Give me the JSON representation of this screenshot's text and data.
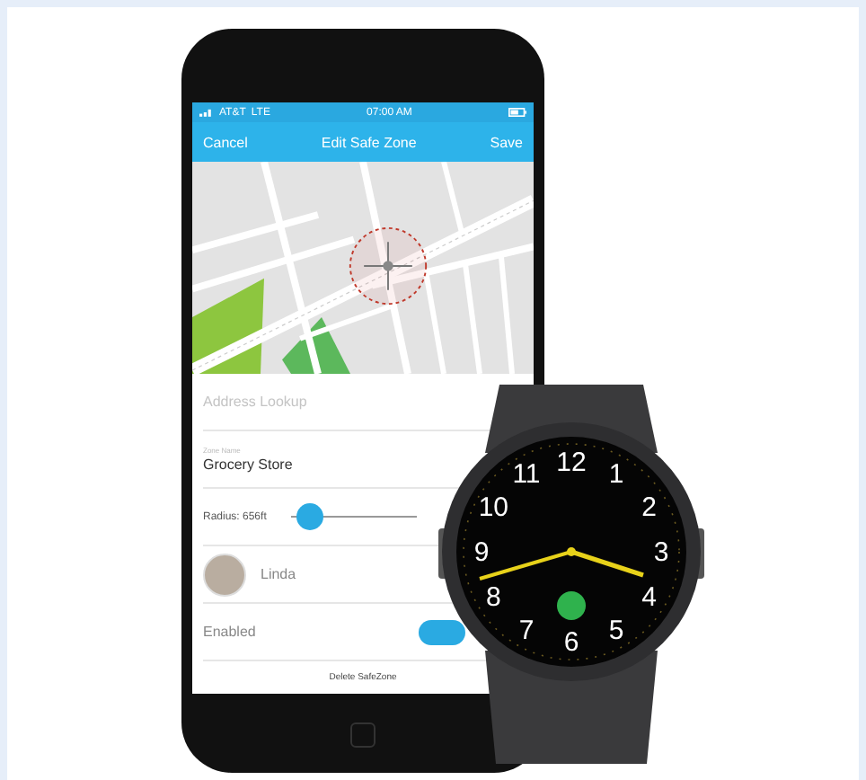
{
  "status_bar": {
    "carrier": "AT&T",
    "network": "LTE",
    "time": "07:00 AM"
  },
  "nav_bar": {
    "left": "Cancel",
    "title": "Edit Safe Zone",
    "right": "Save"
  },
  "form": {
    "address": {
      "placeholder": "Address Lookup"
    },
    "zone_name": {
      "label": "Zone Name",
      "value": "Grocery Store"
    },
    "radius": {
      "label": "Radius: 656ft",
      "level": 0.04
    },
    "person": {
      "name": "Linda"
    },
    "enabled": {
      "label": "Enabled",
      "on": true
    },
    "delete_button": "Delete SafeZone"
  },
  "watch": {
    "dial_numbers": [
      "12",
      "11",
      "1",
      "10",
      "2",
      "9",
      "3",
      "8",
      "4",
      "7",
      "5",
      "6"
    ]
  }
}
